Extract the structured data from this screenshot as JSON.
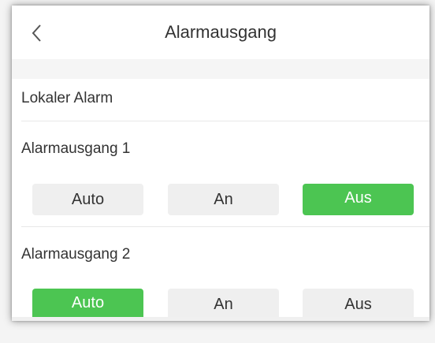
{
  "header": {
    "title": "Alarmausgang",
    "back_icon": "chevron-left-icon"
  },
  "sections": {
    "local_alarm_label": "Lokaler Alarm"
  },
  "outputs": [
    {
      "label": "Alarmausgang 1",
      "options": [
        "Auto",
        "An",
        "Aus"
      ],
      "selected": "Aus"
    },
    {
      "label": "Alarmausgang 2",
      "options": [
        "Auto",
        "An",
        "Aus"
      ],
      "selected": "Auto"
    }
  ],
  "colors": {
    "accent": "#4cc552",
    "inactive_button": "#efefef",
    "text": "#333333"
  }
}
